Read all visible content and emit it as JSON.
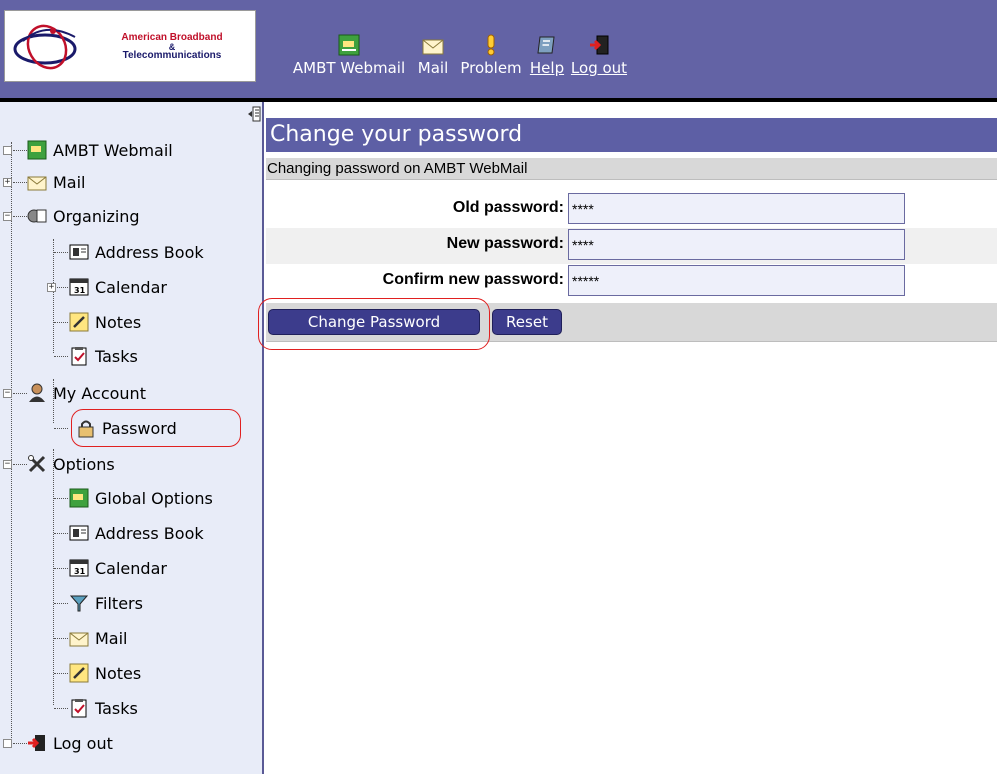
{
  "logo": {
    "line1": "American Broadband",
    "amp": "&",
    "line2": "Telecommunications"
  },
  "topnav": [
    {
      "label": "AMBT Webmail",
      "icon": "webmail-icon"
    },
    {
      "label": "Mail",
      "icon": "envelope-icon"
    },
    {
      "label": "Problem",
      "icon": "exclamation-icon"
    },
    {
      "label": "Help",
      "icon": "help-book-icon"
    },
    {
      "label": "Log out",
      "icon": "logout-icon"
    }
  ],
  "sidebar": {
    "items": [
      {
        "label": "AMBT Webmail"
      },
      {
        "label": "Mail"
      },
      {
        "label": "Organizing"
      },
      {
        "label": "Address Book"
      },
      {
        "label": "Calendar"
      },
      {
        "label": "Notes"
      },
      {
        "label": "Tasks"
      },
      {
        "label": "My Account"
      },
      {
        "label": "Password"
      },
      {
        "label": "Options"
      },
      {
        "label": "Global Options"
      },
      {
        "label": "Address Book"
      },
      {
        "label": "Calendar"
      },
      {
        "label": "Filters"
      },
      {
        "label": "Mail"
      },
      {
        "label": "Notes"
      },
      {
        "label": "Tasks"
      },
      {
        "label": "Log out"
      }
    ]
  },
  "main": {
    "title": "Change your password",
    "subtitle": "Changing password on AMBT WebMail",
    "fields": [
      {
        "label": "Old password:",
        "value": "****"
      },
      {
        "label": "New password:",
        "value": "****"
      },
      {
        "label": "Confirm new password:",
        "value": "*****"
      }
    ],
    "buttons": {
      "change": "Change Password",
      "reset": "Reset"
    }
  },
  "colors": {
    "header": "#6363a5",
    "title_bar": "#5d5fa5",
    "sidebar_bg": "#e8ecf8",
    "button": "#3c3c8c",
    "highlight": "#e02020"
  }
}
